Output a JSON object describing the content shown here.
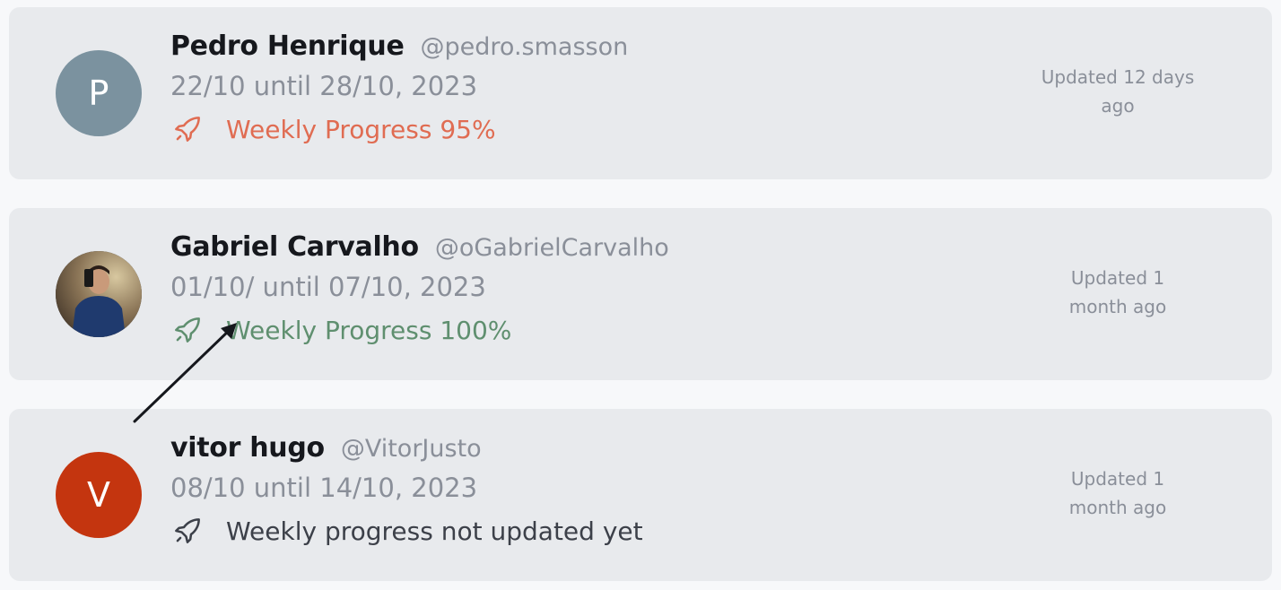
{
  "entries": [
    {
      "name": "Pedro Henrique",
      "handle": "@pedro.smasson",
      "avatar_initial": "P",
      "avatar_color": "#7b929f",
      "dates": "22/10 until 28/10, 2023",
      "progress": "Weekly Progress 95%",
      "progress_color": "#e06c52",
      "updated": "Updated 12 days ago",
      "icon": "rocket-icon"
    },
    {
      "name": "Gabriel Carvalho",
      "handle": "@oGabrielCarvalho",
      "avatar_type": "photo",
      "dates": "01/10/ until 07/10, 2023",
      "progress": "Weekly Progress 100%",
      "progress_color": "#5f8f6f",
      "updated": "Updated 1 month ago",
      "icon": "rocket-icon"
    },
    {
      "name": "vitor hugo",
      "handle": "@VitorJusto",
      "avatar_initial": "V",
      "avatar_color": "#c4350f",
      "dates": "08/10 until 14/10, 2023",
      "progress": "Weekly progress not updated yet",
      "progress_color": "#3c4049",
      "updated": "Updated 1 month ago",
      "icon": "rocket-icon"
    }
  ]
}
